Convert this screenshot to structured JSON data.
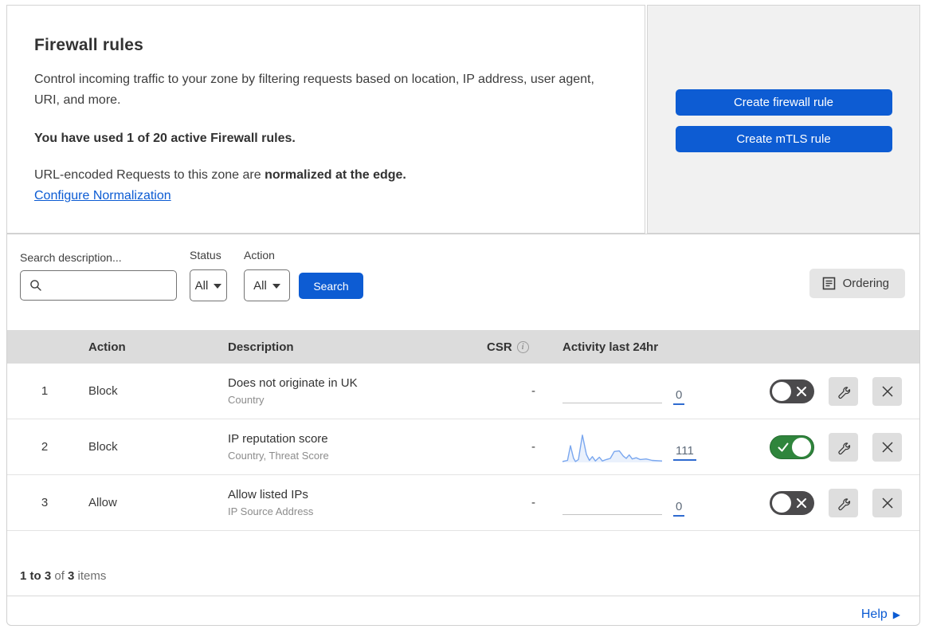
{
  "header": {
    "title": "Firewall rules",
    "description": "Control incoming traffic to your zone by filtering requests based on location, IP address, user agent, URI, and more.",
    "usage_line": "You have used 1 of 20 active Firewall rules.",
    "normalization_text": "URL-encoded Requests to this zone are ",
    "normalization_bold": "normalized at the edge.",
    "normalization_link": "Configure Normalization",
    "create_firewall_button": "Create firewall rule",
    "create_mtls_button": "Create mTLS rule"
  },
  "filters": {
    "search_label": "Search description...",
    "search_placeholder": "",
    "status_label": "Status",
    "status_value": "All",
    "action_label": "Action",
    "action_value": "All",
    "search_button": "Search",
    "ordering_button": "Ordering"
  },
  "table": {
    "columns": {
      "action": "Action",
      "description": "Description",
      "csr": "CSR",
      "activity": "Activity last 24hr"
    },
    "rows": [
      {
        "priority": "1",
        "action": "Block",
        "description": "Does not originate in UK",
        "fields": "Country",
        "csr": "-",
        "activity_count": "0",
        "enabled": false,
        "sparkline": null
      },
      {
        "priority": "2",
        "action": "Block",
        "description": "IP reputation score",
        "fields": "Country, Threat Score",
        "csr": "-",
        "activity_count": "111",
        "enabled": true,
        "sparkline": [
          [
            0,
            0.97
          ],
          [
            0.05,
            0.93
          ],
          [
            0.08,
            0.42
          ],
          [
            0.11,
            0.85
          ],
          [
            0.13,
            0.97
          ],
          [
            0.16,
            0.9
          ],
          [
            0.2,
            0.05
          ],
          [
            0.24,
            0.72
          ],
          [
            0.27,
            0.93
          ],
          [
            0.3,
            0.8
          ],
          [
            0.33,
            0.95
          ],
          [
            0.37,
            0.82
          ],
          [
            0.4,
            0.95
          ],
          [
            0.44,
            0.9
          ],
          [
            0.48,
            0.86
          ],
          [
            0.52,
            0.62
          ],
          [
            0.57,
            0.6
          ],
          [
            0.61,
            0.78
          ],
          [
            0.64,
            0.86
          ],
          [
            0.67,
            0.74
          ],
          [
            0.7,
            0.88
          ],
          [
            0.74,
            0.84
          ],
          [
            0.78,
            0.9
          ],
          [
            0.84,
            0.88
          ],
          [
            0.9,
            0.93
          ],
          [
            1,
            0.95
          ]
        ]
      },
      {
        "priority": "3",
        "action": "Allow",
        "description": "Allow listed IPs",
        "fields": "IP Source Address",
        "csr": "-",
        "activity_count": "0",
        "enabled": false,
        "sparkline": null
      }
    ]
  },
  "footer": {
    "range_bold": "1 to 3",
    "of_text": " of ",
    "total_bold": "3",
    "items_text": " items",
    "help_link": "Help"
  },
  "colors": {
    "accent_blue": "#0d5cd3",
    "link_blue": "#0b5bd3",
    "toggle_on_green": "#2f853c",
    "toggle_off_gray": "#4b4a4c",
    "sparkline_blue": "#7aa7ef",
    "table_header_gray": "#dcdcdc"
  }
}
